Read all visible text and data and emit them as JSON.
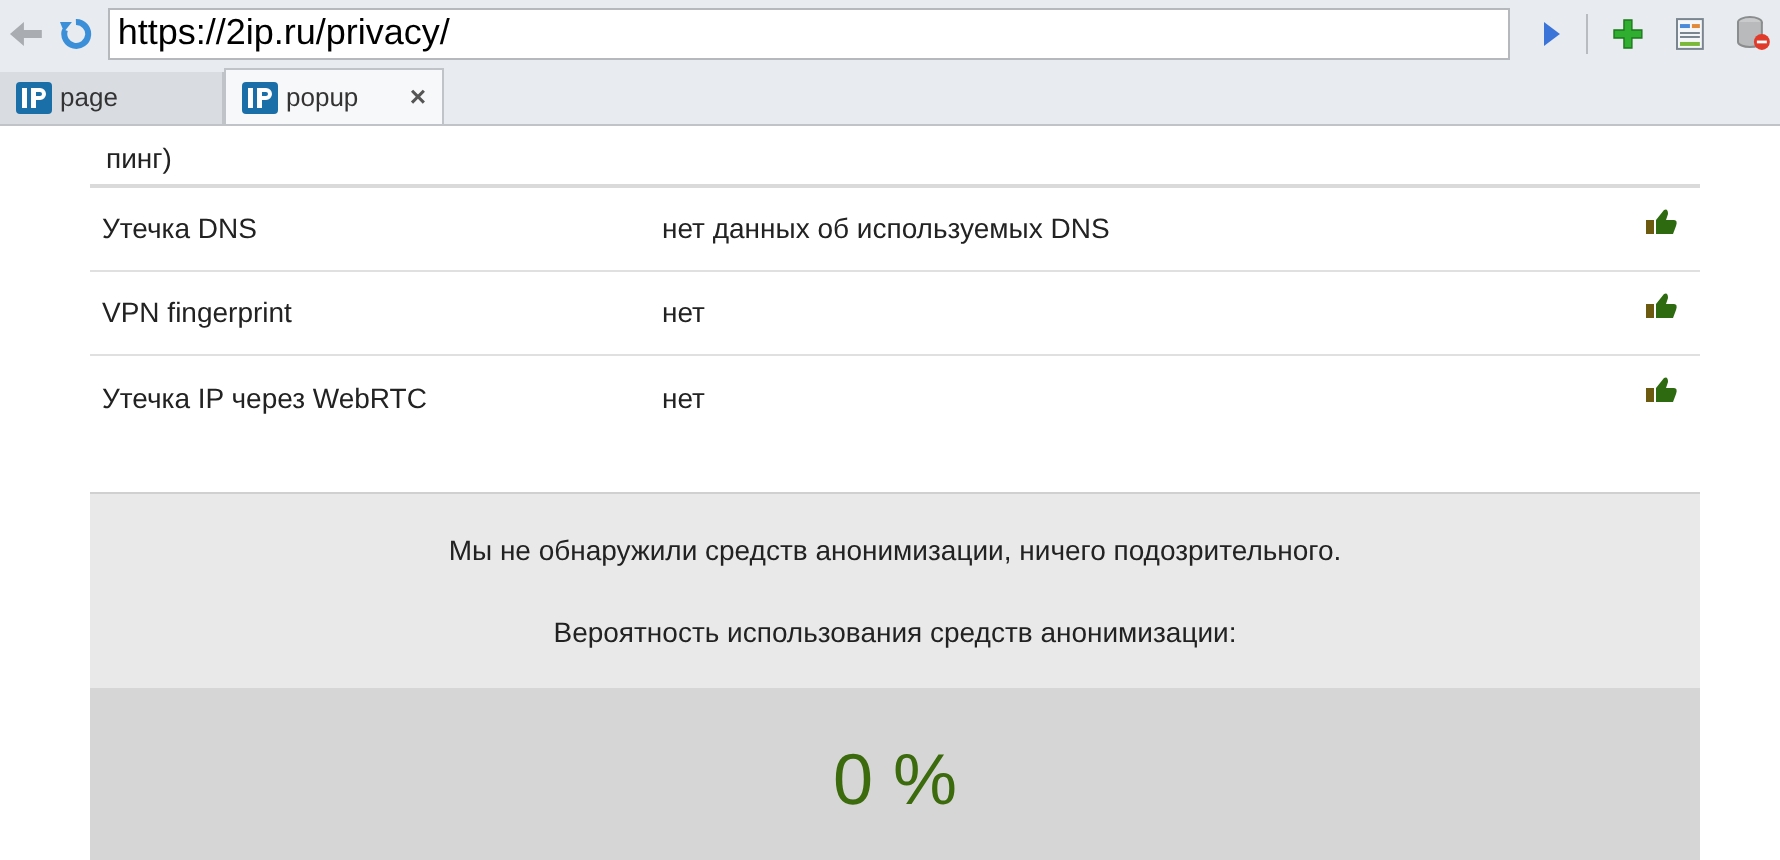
{
  "address_bar": {
    "url": "https://2ip.ru/privacy/"
  },
  "tabs": [
    {
      "label": "page",
      "selected": false
    },
    {
      "label": "popup",
      "selected": true,
      "close": "×"
    }
  ],
  "cut_text": "пинг)",
  "rows": [
    {
      "name": "Утечка DNS",
      "value": "нет данных об используемых DNS",
      "ok": true
    },
    {
      "name": "VPN fingerprint",
      "value": "нет",
      "ok": true
    },
    {
      "name": "Утечка IP через WebRTC",
      "value": "нет",
      "ok": true
    }
  ],
  "summary": {
    "message": "Мы не обнаружили средств анонимизации, ничего подозрительного.",
    "probability_label": "Вероятность использования средств анонимизации:",
    "probability": "0 %"
  }
}
